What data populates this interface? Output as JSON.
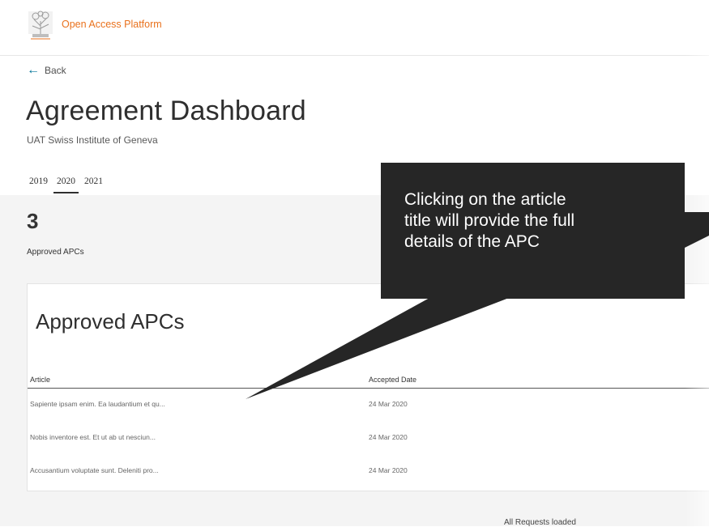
{
  "header": {
    "brand": "Open Access Platform",
    "logo_text": "ELSEVIER",
    "logo_icon": "elsevier-tree-logo"
  },
  "nav": {
    "back_label": "Back",
    "back_icon": "arrow-left-icon"
  },
  "page": {
    "title": "Agreement Dashboard",
    "subtitle": "UAT Swiss Institute of Geneva"
  },
  "years": {
    "items": [
      "2019",
      "2020",
      "2021"
    ],
    "selected": "2020"
  },
  "summary": {
    "count": "3",
    "label": "Approved APCs"
  },
  "table": {
    "title": "Approved APCs",
    "columns": [
      "Article",
      "Accepted Date"
    ],
    "rows": [
      {
        "article": "Sapiente ipsam enim. Ea laudantium et qu...",
        "date": "24 Mar 2020"
      },
      {
        "article": "Nobis inventore est. Et ut ab ut nesciun...",
        "date": "24 Mar 2020"
      },
      {
        "article": "Accusantium voluptate sunt. Deleniti pro...",
        "date": "24 Mar 2020"
      }
    ]
  },
  "footer": {
    "status": "All Requests loaded"
  },
  "callout": {
    "line1": "Clicking on the article",
    "line2": "title will provide the full",
    "line3": "details of the APC"
  },
  "colors": {
    "brand": "#e9711c",
    "accent": "#007398",
    "callout_bg": "#262626"
  }
}
